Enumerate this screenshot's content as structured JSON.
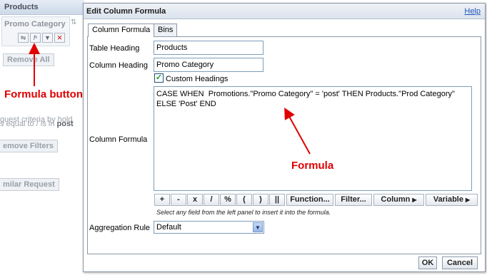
{
  "background": {
    "panel_title": "Products",
    "column_name": "Promo Category",
    "remove_all_label": "Remove All",
    "request_text": "quest criteria by hold",
    "filter_text_prefix": "s equal to / is in ",
    "filter_text_value": "post",
    "remove_filters_label": "emove Filters",
    "similar_request_label": "milar Request"
  },
  "annotations": {
    "formula_button_label": "Formula button",
    "formula_label": "Formula",
    "color": "#e00000"
  },
  "dialog": {
    "title": "Edit Column Formula",
    "help_label": "Help",
    "tabs": [
      {
        "label": "Column Formula",
        "active": true
      },
      {
        "label": "Bins",
        "active": false
      }
    ],
    "table_heading_label": "Table Heading",
    "table_heading_value": "Products",
    "column_heading_label": "Column Heading",
    "column_heading_value": "Promo Category",
    "custom_headings_label": "Custom Headings",
    "custom_headings_checked": true,
    "column_formula_label": "Column Formula",
    "formula_text": "CASE WHEN  Promotions.\"Promo Category\" = 'post' THEN Products.\"Prod Category\" ELSE 'Post' END",
    "operators": [
      "+",
      "-",
      "x",
      "/",
      "%",
      "(",
      ")",
      "||"
    ],
    "function_button_label": "Function...",
    "filter_button_label": "Filter...",
    "column_button_label": "Column",
    "variable_button_label": "Variable",
    "hint_text": "Select any field from the left panel to insert it into the formula.",
    "aggregation_rule_label": "Aggregation Rule",
    "aggregation_rule_value": "Default",
    "ok_label": "OK",
    "cancel_label": "Cancel"
  }
}
